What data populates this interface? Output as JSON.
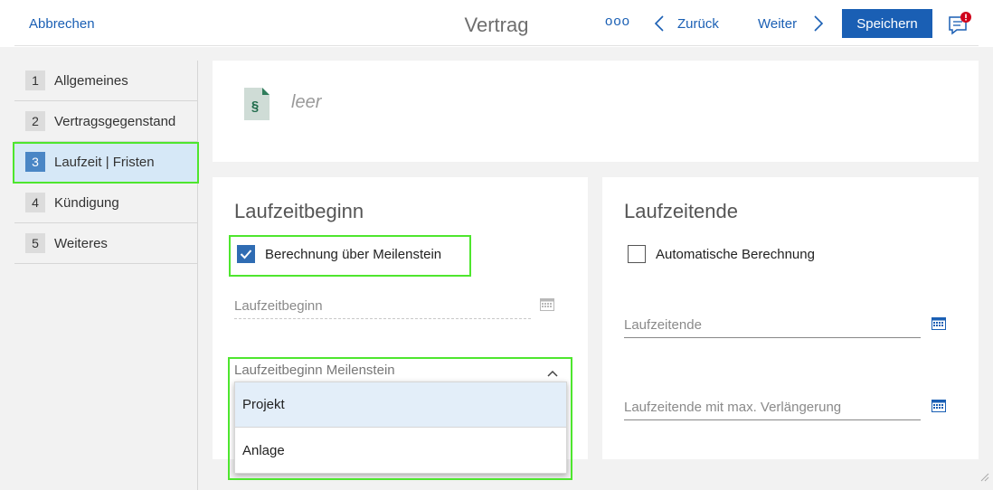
{
  "header": {
    "cancel_label": "Abbrechen",
    "title": "Vertrag",
    "more_label": "ooo",
    "back_label": "Zurück",
    "next_label": "Weiter",
    "save_label": "Speichern"
  },
  "sidebar": {
    "items": [
      {
        "num": "1",
        "label": "Allgemeines"
      },
      {
        "num": "2",
        "label": "Vertragsgegenstand"
      },
      {
        "num": "3",
        "label": "Laufzeit | Fristen",
        "active": true
      },
      {
        "num": "4",
        "label": "Kündigung"
      },
      {
        "num": "5",
        "label": "Weiteres"
      }
    ]
  },
  "document": {
    "icon_symbol": "§",
    "placeholder": "leer"
  },
  "laufzeitbeginn": {
    "title": "Laufzeitbeginn",
    "checkbox_label": "Berechnung über Meilenstein",
    "checkbox_checked": true,
    "date_placeholder": "Laufzeitbeginn",
    "milestone_label": "Laufzeitbeginn Meilenstein",
    "options": [
      "Projekt",
      "Anlage"
    ]
  },
  "laufzeitende": {
    "title": "Laufzeitende",
    "checkbox_label": "Automatische Berechnung",
    "checkbox_checked": false,
    "end_placeholder": "Laufzeitende",
    "max_placeholder": "Laufzeitende mit max. Verlängerung"
  },
  "colors": {
    "accent": "#1a5fb4",
    "highlight": "#4ee62e",
    "active_step": "#d6e8f7",
    "notification": "#d0021b"
  }
}
